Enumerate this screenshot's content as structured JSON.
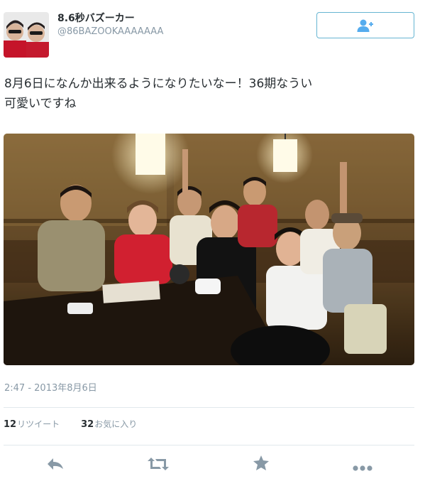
{
  "user": {
    "display_name": "8.6秒バズーカー",
    "handle": "@86BAZOOKAAAAAAA"
  },
  "follow_button": {
    "icon": "follow-user-icon"
  },
  "tweet": {
    "lines": [
      "8月6日になんか出来るようになりたいなー！36期なうい",
      "可愛いですね"
    ],
    "timestamp": "2:47 - 2013年8月6日"
  },
  "stats": {
    "retweets_count": "12",
    "retweets_label": "リツイート",
    "favorites_count": "32",
    "favorites_label": "お気に入り"
  },
  "actions": {
    "reply_icon": "reply-icon",
    "retweet_icon": "retweet-icon",
    "favorite_icon": "star-icon",
    "more_icon": "more-icon"
  },
  "colors": {
    "accent": "#55acee",
    "text": "#292f33",
    "secondary_text": "#8899a6",
    "action_icon": "#8899a6",
    "border": "#e1e8ed"
  }
}
